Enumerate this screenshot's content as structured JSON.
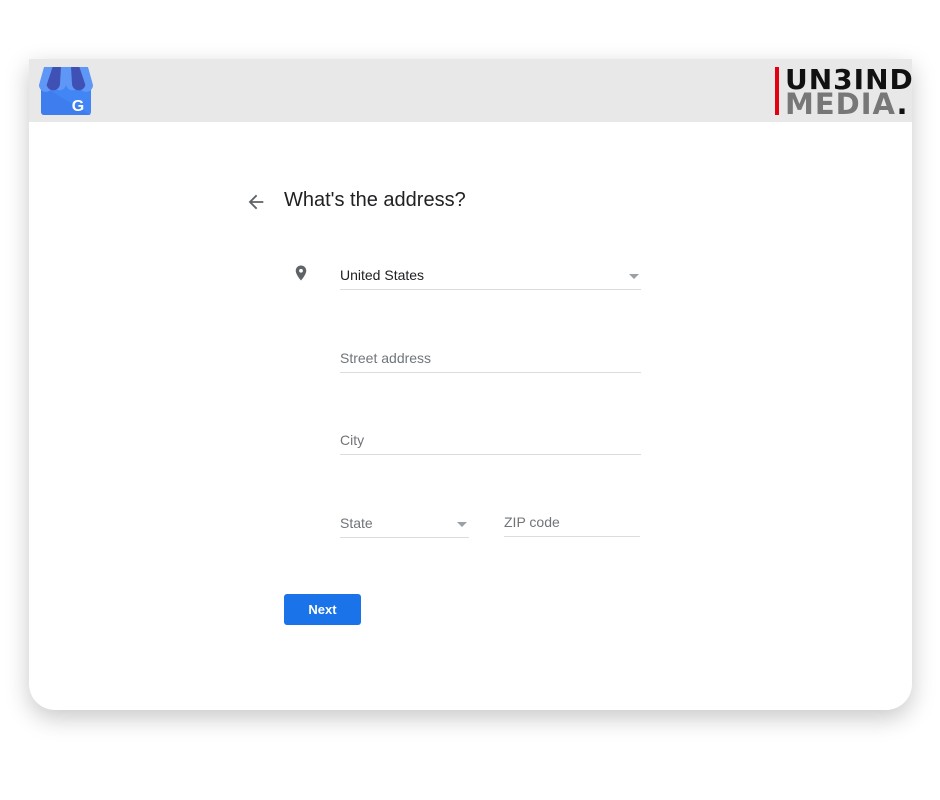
{
  "brand": {
    "logo_text_line1": "UN3IND",
    "logo_text_line2": "MEDIA",
    "accent": "#e3000f"
  },
  "form": {
    "title": "What's the address?",
    "country": "United States",
    "street_placeholder": "Street address",
    "city_placeholder": "City",
    "state_placeholder": "State",
    "zip_placeholder": "ZIP code",
    "next_label": "Next"
  },
  "colors": {
    "primary": "#1a73e8",
    "header_bg": "#e8e8e8"
  }
}
